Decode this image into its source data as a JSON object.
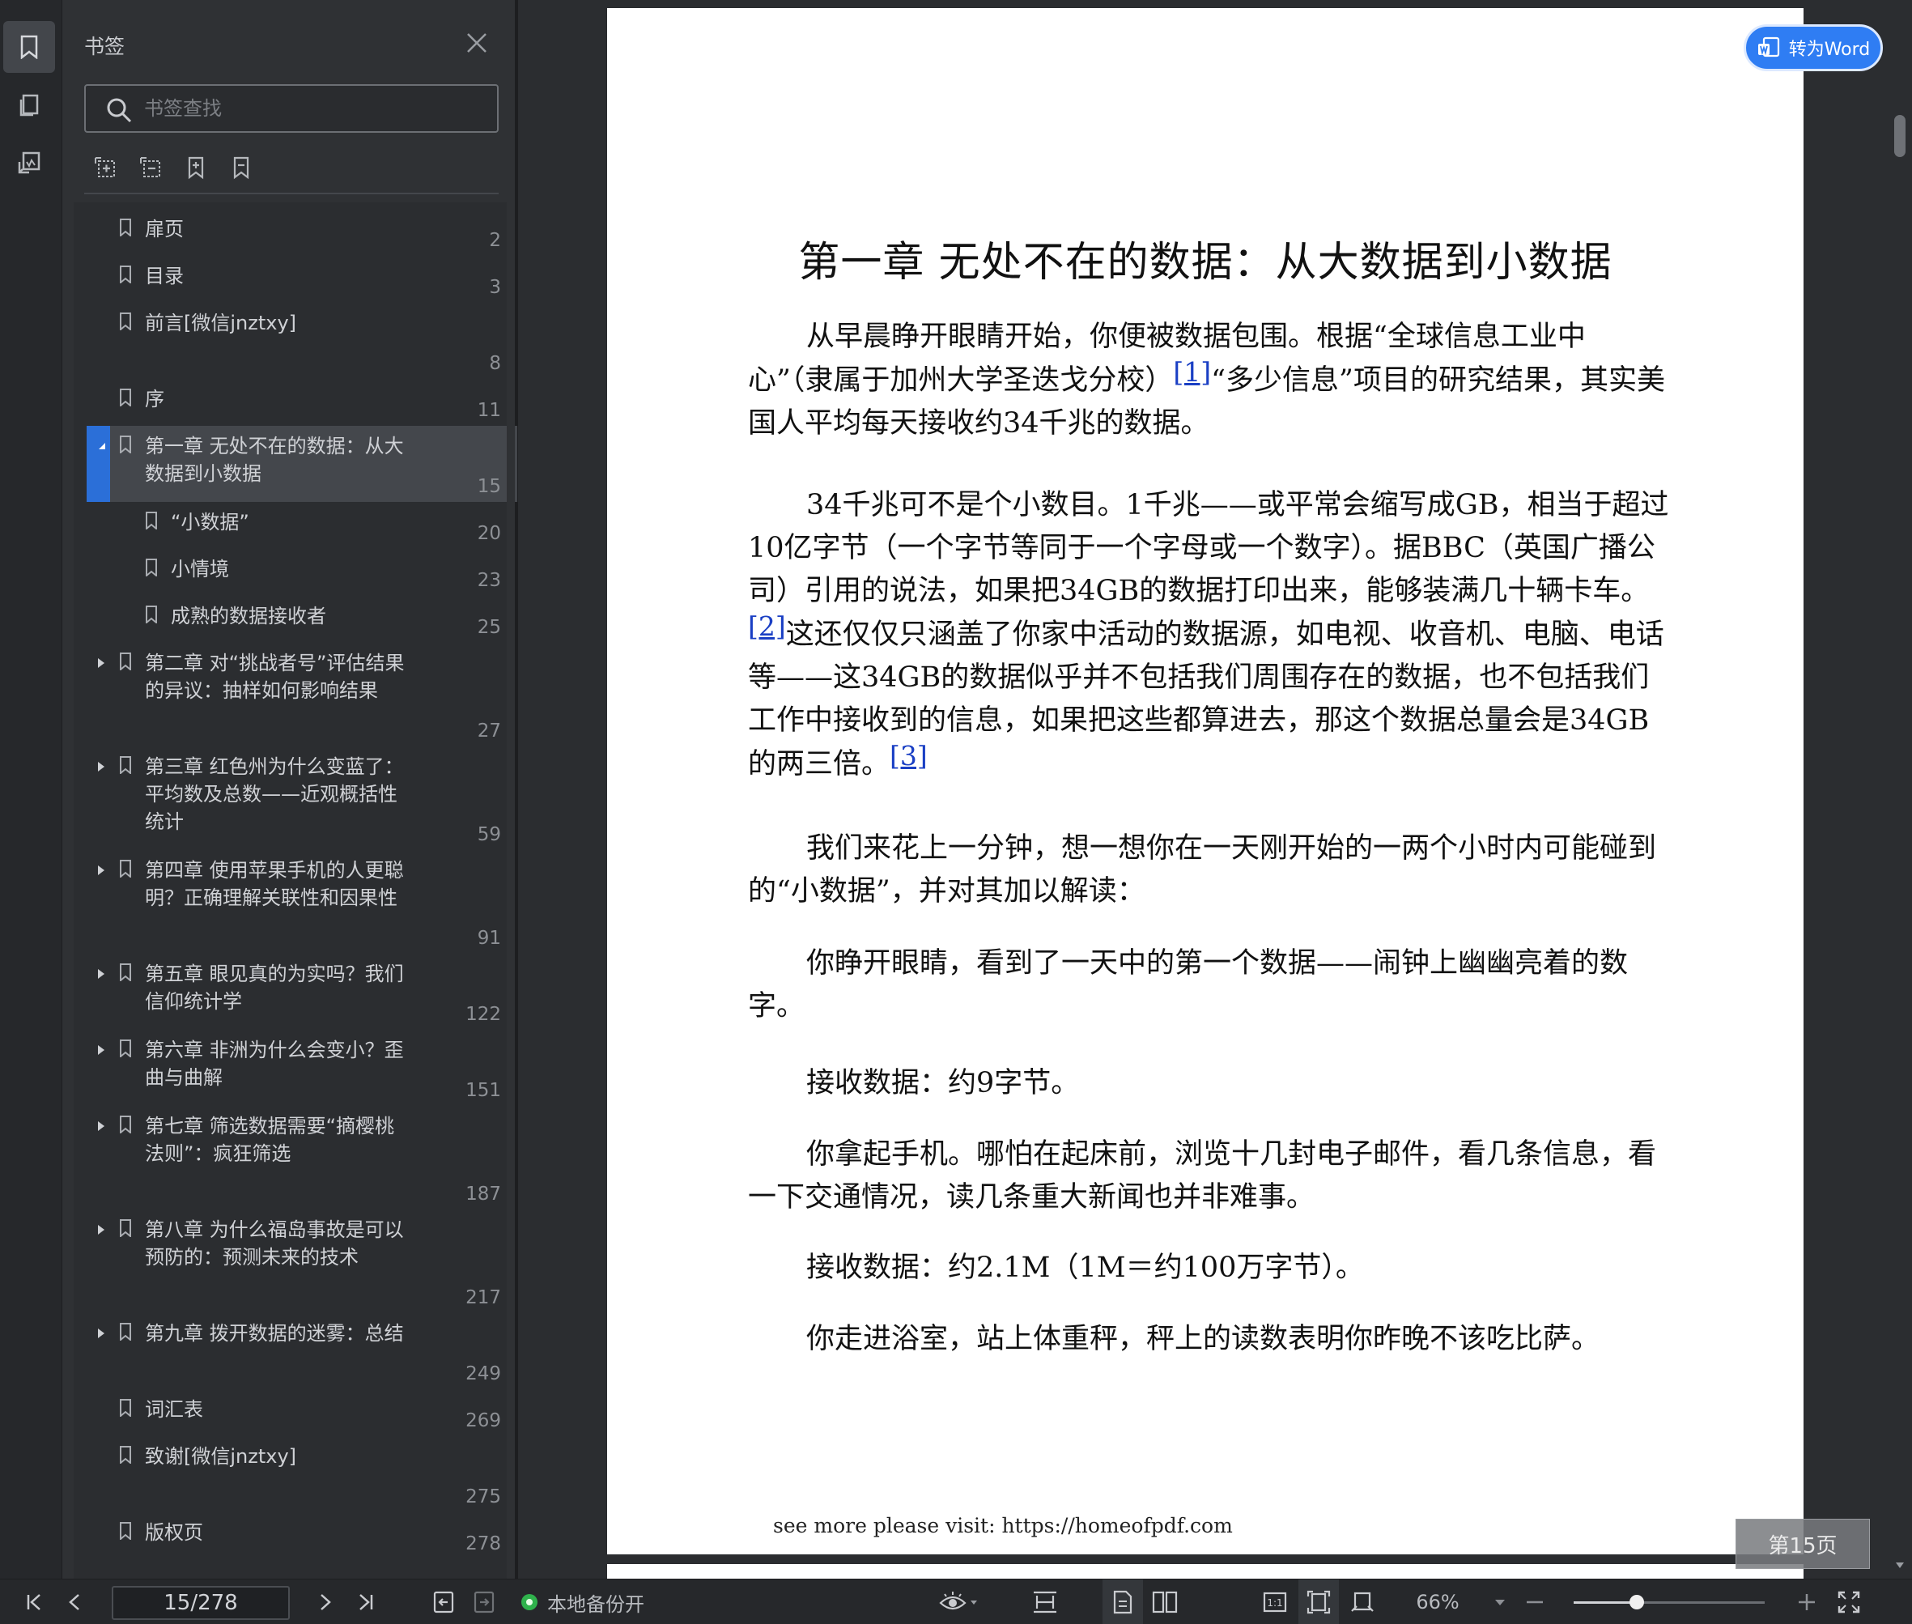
{
  "sidebar": {
    "title": "书签",
    "search_placeholder": "书签查找",
    "tool_icons": [
      "expand-all-icon",
      "collapse-all-icon",
      "add-bookmark-icon",
      "remove-bookmark-icon"
    ],
    "bookmarks": [
      {
        "label": "扉页",
        "page": "2",
        "level": 0,
        "arrow": "none"
      },
      {
        "label": "目录",
        "page": "3",
        "level": 0,
        "arrow": "none"
      },
      {
        "label": "前言[微信jnztxy]",
        "page": "8",
        "level": 0,
        "arrow": "none"
      },
      {
        "label": "序",
        "page": "11",
        "level": 0,
        "arrow": "none"
      },
      {
        "label": "第一章 无处不在的数据：从大数据到小数据",
        "page": "15",
        "level": 0,
        "arrow": "expanded",
        "selected": true
      },
      {
        "label": "“小数据”",
        "page": "20",
        "level": 1,
        "arrow": "none"
      },
      {
        "label": "小情境",
        "page": "23",
        "level": 1,
        "arrow": "none"
      },
      {
        "label": "成熟的数据接收者",
        "page": "25",
        "level": 1,
        "arrow": "none"
      },
      {
        "label": "第二章 对“挑战者号”评估结果的异议：抽样如何影响结果",
        "page": "27",
        "level": 0,
        "arrow": "collapsed"
      },
      {
        "label": "第三章 红色州为什么变蓝了：平均数及总数——近观概括性统计",
        "page": "59",
        "level": 0,
        "arrow": "collapsed"
      },
      {
        "label": "第四章 使用苹果手机的人更聪明？正确理解关联性和因果性",
        "page": "91",
        "level": 0,
        "arrow": "collapsed"
      },
      {
        "label": "第五章 眼见真的为实吗？我们信仰统计学",
        "page": "122",
        "level": 0,
        "arrow": "collapsed"
      },
      {
        "label": "第六章 非洲为什么会变小？歪曲与曲解",
        "page": "151",
        "level": 0,
        "arrow": "collapsed"
      },
      {
        "label": "第七章 筛选数据需要“摘樱桃法则”：疯狂筛选",
        "page": "187",
        "level": 0,
        "arrow": "collapsed"
      },
      {
        "label": "第八章 为什么福岛事故是可以预防的：预测未来的技术",
        "page": "217",
        "level": 0,
        "arrow": "collapsed"
      },
      {
        "label": "第九章 拨开数据的迷雾：总结",
        "page": "249",
        "level": 0,
        "arrow": "collapsed"
      },
      {
        "label": "词汇表",
        "page": "269",
        "level": 0,
        "arrow": "none"
      },
      {
        "label": "致谢[微信jnztxy]",
        "page": "275",
        "level": 0,
        "arrow": "none"
      },
      {
        "label": "版权页",
        "page": "278",
        "level": 0,
        "arrow": "none"
      }
    ]
  },
  "document": {
    "chapter_title": "第一章 无处不在的数据：从大数据到小数据",
    "p1_a": "从早晨睁开眼睛开始，你便被数据包围。根据“全球信息工业中心”（隶属于加州大学圣迭戈分校）",
    "p1_fn": "[1]",
    "p1_b": "“多少信息”项目的研究结果，其实美国人平均每天接收约34千兆的数据。",
    "p2_a": "34千兆可不是个小数目。1千兆——或平常会缩写成GB，相当于超过10亿字节（一个字节等同于一个字母或一个数字）。据BBC（英国广播公司）引用的说法，如果把34GB的数据打印出来，能够装满几十辆卡车。",
    "p2_fn1": "[2]",
    "p2_b": "这还仅仅只涵盖了你家中活动的数据源，如电视、收音机、电脑、电话等——这34GB的数据似乎并不包括我们周围存在的数据，也不包括我们工作中接收到的信息，如果把这些都算进去，那这个数据总量会是34GB的两三倍。",
    "p2_fn2": "[3]",
    "p3": "我们来花上一分钟，想一想你在一天刚开始的一两个小时内可能碰到的“小数据”，并对其加以解读：",
    "p4": "你睁开眼睛，看到了一天中的第一个数据——闹钟上幽幽亮着的数字。",
    "p5": "接收数据：约9字节。",
    "p6": "你拿起手机。哪怕在起床前，浏览十几封电子邮件，看几条信息，看一下交通情况，读几条重大新闻也并非难事。",
    "p7": "接收数据：约2.1M（1M＝约100万字节）。",
    "p8": "你走进浴室，站上体重秤，秤上的读数表明你昨晚不该吃比萨。",
    "footer": "see more please visit: https://homeofpdf.com",
    "to_word": "转为Word",
    "page_badge": "第15页"
  },
  "statusbar": {
    "page_value": "15/278",
    "backup_label": "本地备份开",
    "zoom": "66%",
    "zoom_fraction": 0.33,
    "backup_color": "#2fb24c",
    "accent": "#2b6fd8"
  }
}
